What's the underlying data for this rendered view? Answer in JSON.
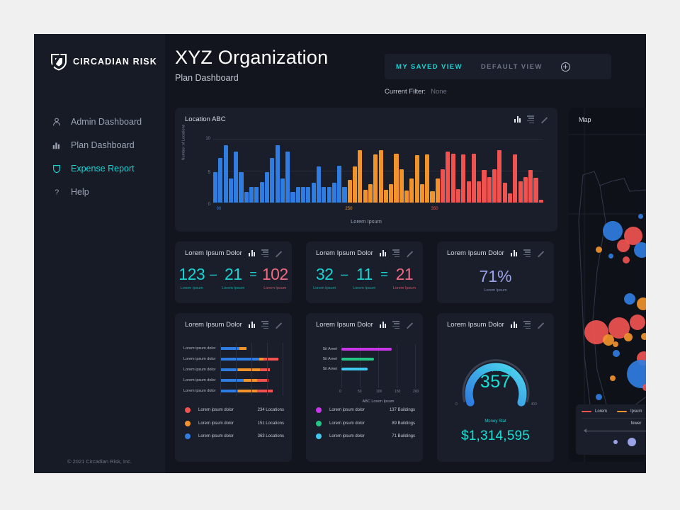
{
  "brand": {
    "name": "CIRCADIAN RISK",
    "logo_icon": "shield-logo-icon"
  },
  "sidebar": {
    "items": [
      {
        "label": "Admin Dashboard",
        "icon": "user-icon",
        "active": false
      },
      {
        "label": "Plan Dashboard",
        "icon": "bar-chart-icon",
        "active": false
      },
      {
        "label": "Expense Report",
        "icon": "shield-icon",
        "active": true
      },
      {
        "label": "Help",
        "icon": "question-mark-icon",
        "active": false
      }
    ],
    "copyright": "© 2021 Circadian Risk, Inc."
  },
  "header": {
    "title": "XYZ Organization",
    "subtitle": "Plan Dashboard",
    "tabs": [
      {
        "label": "MY SAVED VIEW",
        "active": true
      },
      {
        "label": "DEFAULT VIEW",
        "active": false
      }
    ],
    "add_view_icon": "plus-circle-icon",
    "filter_label": "Current Filter:",
    "filter_value": "None"
  },
  "card_icons": {
    "chart": "bar-chart-icon",
    "list": "list-icon",
    "expand": "expand-arrow-icon"
  },
  "colors": {
    "accent": "#19d3d3",
    "blue": "#2f7de1",
    "orange": "#f0932b",
    "red": "#ef5350",
    "purple": "#9aa2e8",
    "magenta": "#c936e8",
    "green": "#25c685",
    "cyan": "#42c8f0"
  },
  "main_chart_card": {
    "title": "Location ABC"
  },
  "chart_data": [
    {
      "type": "bar",
      "title": "Location ABC",
      "xlabel": "Lorem Ipsum",
      "ylabel": "Number of Locations",
      "ylim": [
        0,
        10
      ],
      "yticks": [
        0,
        5,
        10
      ],
      "xtick_labels": [
        {
          "label": "90",
          "color": "#2f7de1",
          "pos_pct": 1
        },
        {
          "label": "250",
          "color": "#f0932b",
          "pos_pct": 40
        },
        {
          "label": "350",
          "color": "#ef5350",
          "pos_pct": 66
        }
      ],
      "grid": true,
      "series": [
        {
          "name": "blue-group",
          "color": "#2f7de1",
          "values": [
            4.8,
            7,
            9,
            3.8,
            8,
            4.8,
            1.7,
            2.4,
            2.4,
            3.2,
            4.8,
            7,
            9,
            3.8,
            8,
            1.7,
            2.5,
            2.5,
            2.4,
            3.1,
            5.7,
            2.4,
            2.4,
            3.1,
            5.8,
            2.4
          ]
        },
        {
          "name": "orange-group",
          "color": "#f0932b",
          "values": [
            3.6,
            5.7,
            8.2,
            2,
            2.9,
            7.6,
            8.2,
            2,
            2.9,
            7.7,
            5.2,
            1.9,
            3.8,
            7.5,
            2.9,
            7.6,
            1.8,
            3.8
          ]
        },
        {
          "name": "red-group",
          "color": "#ef5350",
          "values": [
            5.2,
            8,
            7.7,
            2.1,
            7.6,
            3.3,
            7.7,
            3.3,
            5.1,
            4,
            5.2,
            8.2,
            3.1,
            1.5,
            7.6,
            3.3,
            4,
            5.1,
            3.9,
            0.5
          ]
        }
      ]
    },
    {
      "type": "bar",
      "orientation": "horizontal",
      "title": "Lorem Ipsum Dolor",
      "categories": [
        "Lorem ipsum dolor",
        "Lorem ipsum dolor",
        "Lorem ipsum dolor",
        "Lorem ipsum dolor",
        "Lorem ipsum dolor"
      ],
      "stacked": true,
      "series": [
        {
          "name": "blue",
          "color": "#2f7de1",
          "values": [
            33,
            67,
            30,
            40,
            30
          ]
        },
        {
          "name": "orange",
          "color": "#f0932b",
          "values": [
            12,
            8,
            38,
            23,
            33
          ]
        },
        {
          "name": "red",
          "color": "#ef5350",
          "values": [
            0,
            25,
            17,
            20,
            27
          ]
        }
      ],
      "legend": [
        {
          "color": "#ef5350",
          "label": "Lorem ipsum dolor",
          "value": "234 Locations"
        },
        {
          "color": "#f0932b",
          "label": "Lorem ipsum dolor",
          "value": "151 Locations"
        },
        {
          "color": "#2f7de1",
          "label": "Lorem ipsum dolor",
          "value": "363 Locations"
        }
      ]
    },
    {
      "type": "bar",
      "orientation": "horizontal",
      "title": "Lorem Ipsum Dolor",
      "xlabel": "ABC Lorem Ipsum",
      "xlim": [
        0,
        200
      ],
      "xticks": [
        0,
        50,
        100,
        150,
        200
      ],
      "categories": [
        "Sit Amet",
        "Sit Amet",
        "Sit Amet"
      ],
      "values": [
        137,
        89,
        71
      ],
      "colors": [
        "#c936e8",
        "#25c685",
        "#42c8f0"
      ],
      "legend": [
        {
          "color": "#c936e8",
          "label": "Lorem ipsum dolor",
          "value": "137 Buildings"
        },
        {
          "color": "#25c685",
          "label": "Lorem ipsum dolor",
          "value": "89 Buildings"
        },
        {
          "color": "#42c8f0",
          "label": "Lorem ipsum dolor",
          "value": "71 Buildings"
        }
      ]
    },
    {
      "type": "gauge",
      "title": "Lorem Ipsum Dolor",
      "caption": "Lorem Ipsum Dolor",
      "value": "357",
      "min_label": "0",
      "max_label": "400",
      "percent": 0.74,
      "money_caption": "Money Stat",
      "money_value": "$1,314,595"
    }
  ],
  "stat_cards": [
    {
      "title": "Lorem Ipsum Dolor",
      "type": "equation",
      "terms": [
        {
          "num": "123",
          "sub": "Lorem Ipsum",
          "color": "#19d3d3"
        },
        {
          "op": "–"
        },
        {
          "num": "21",
          "sub": "Lorem Ipsum",
          "color": "#19d3d3"
        },
        {
          "op": "="
        },
        {
          "num": "102",
          "sub": "Lorem Ipsum",
          "color": "#ef6b82"
        }
      ]
    },
    {
      "title": "Lorem Ipsum Dolor",
      "type": "equation",
      "terms": [
        {
          "num": "32",
          "sub": "Lorem Ipsum",
          "color": "#19d3d3"
        },
        {
          "op": "–"
        },
        {
          "num": "11",
          "sub": "Lorem Ipsum",
          "color": "#19d3d3"
        },
        {
          "op": "="
        },
        {
          "num": "21",
          "sub": "Lorem Ipsum",
          "color": "#ef6b82"
        }
      ]
    },
    {
      "title": "Lorem Ipsum Dolor",
      "type": "percent",
      "value": "71%",
      "sub": "Lorem Ipsum"
    }
  ],
  "bottom_cards": [
    {
      "title": "Lorem Ipsum Dolor"
    },
    {
      "title": "Lorem Ipsum Dolor"
    },
    {
      "title": "Lorem Ipsum Dolor"
    }
  ],
  "map": {
    "title": "Map",
    "legend": {
      "items": [
        {
          "label": "Lorem",
          "color": "#ef5350"
        },
        {
          "label": "Ipsum",
          "color": "#f0932b"
        }
      ],
      "scale_label": "fewer"
    }
  }
}
